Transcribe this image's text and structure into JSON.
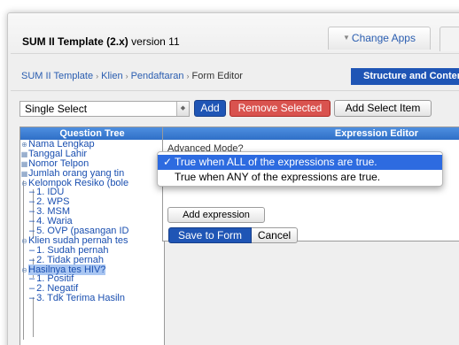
{
  "header": {
    "app_name": "SUM II Template (2.x)",
    "version_text": "version 11",
    "change_apps": "Change Apps"
  },
  "breadcrumb": {
    "items": [
      "SUM II Template",
      "Klien",
      "Pendaftaran"
    ],
    "current": "Form Editor",
    "separator": "›"
  },
  "structure_button": "Structure and Content",
  "toolbar": {
    "select_value": "Single Select",
    "add_label": "Add",
    "remove_label": "Remove Selected",
    "add_select_label": "Add Select Item"
  },
  "question_tree": {
    "title": "Question Tree",
    "items": [
      {
        "label": "Nama Lengkap",
        "level": 0,
        "icon": "text-field-icon"
      },
      {
        "label": "Tanggal Lahir",
        "level": 0,
        "icon": "date-field-icon"
      },
      {
        "label": "Nomor Telpon",
        "level": 0,
        "icon": "number-field-icon"
      },
      {
        "label": "Jumlah orang yang tin",
        "level": 0,
        "icon": "number-field-icon"
      },
      {
        "label": "Kelompok Resiko (bole",
        "level": 0,
        "icon": "multi-select-icon"
      },
      {
        "label": "1. IDU",
        "level": 1
      },
      {
        "label": "2. WPS",
        "level": 1
      },
      {
        "label": "3. MSM",
        "level": 1
      },
      {
        "label": "4. Waria",
        "level": 1
      },
      {
        "label": "5. OVP (pasangan ID",
        "level": 1
      },
      {
        "label": "Klien sudah pernah tes",
        "level": 0,
        "icon": "single-select-icon"
      },
      {
        "label": "1. Sudah pernah",
        "level": 1
      },
      {
        "label": "2. Tidak pernah",
        "level": 1
      },
      {
        "label": "Hasilnya tes HIV?",
        "level": 0,
        "icon": "single-select-icon",
        "selected": true
      },
      {
        "label": "1. Positif",
        "level": 1
      },
      {
        "label": "2. Negatif",
        "level": 1
      },
      {
        "label": "3. Tdk Terima Hasiln",
        "level": 1
      }
    ]
  },
  "expression_editor": {
    "title": "Expression Editor",
    "advanced_mode": "Advanced Mode?",
    "add_expression": "Add expression",
    "save_label": "Save to Form",
    "cancel_label": "Cancel"
  },
  "dropdown": {
    "options": [
      {
        "label": "True when ALL of the expressions are true.",
        "checked": true
      },
      {
        "label": "True when ANY of the expressions are true.",
        "checked": false
      }
    ]
  },
  "colors": {
    "primary": "#1f55b5",
    "danger": "#d9534f",
    "panel_header": "#3a7ad4",
    "highlight": "#2d6be0"
  }
}
